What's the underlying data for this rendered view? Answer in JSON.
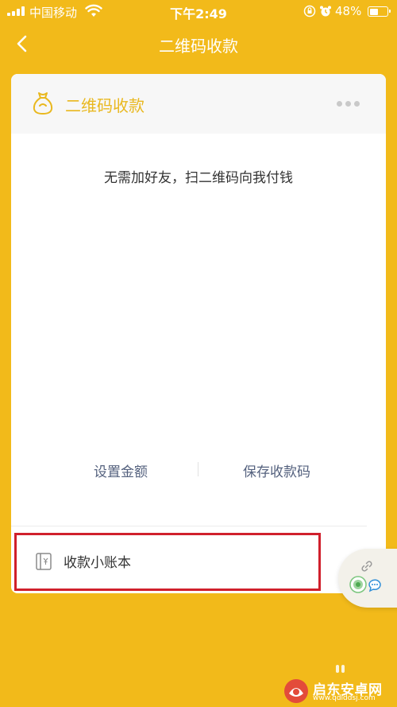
{
  "status_bar": {
    "carrier": "中国移动",
    "time": "下午2:49",
    "battery_percent": "48%",
    "battery_level": 0.48,
    "icons": [
      "signal-icon",
      "wifi-icon",
      "orientation-lock-icon",
      "alarm-icon",
      "battery-icon"
    ]
  },
  "nav": {
    "title": "二维码收款",
    "back_icon": "chevron-left-icon"
  },
  "card": {
    "title": "二维码收款",
    "icon": "money-bag-icon",
    "menu_icon": "more-icon",
    "description": "无需加好友，扫二维码向我付钱",
    "set_amount": "设置金额",
    "save_qr": "保存收款码",
    "ledger_label": "收款小账本",
    "ledger_icon": "ledger-icon"
  },
  "float_widget": {
    "icons": [
      "link-icon",
      "app-icon",
      "chat-icon"
    ]
  },
  "watermark": {
    "name": "启东安卓网",
    "url": "www.qdlddsj.com"
  },
  "colors": {
    "background": "#F2BA1A",
    "card": "#FFFFFF",
    "card_header": "#F7F7F7",
    "title_accent": "#E9B81F",
    "link_text": "#54617E",
    "highlight": "#D0202C"
  }
}
